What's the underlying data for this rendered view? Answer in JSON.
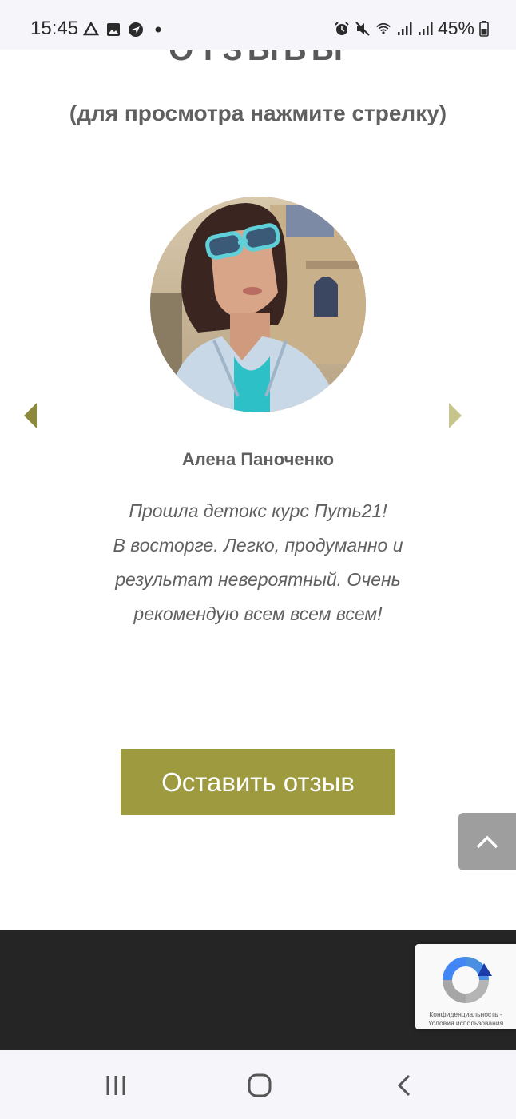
{
  "status_bar": {
    "time": "15:45",
    "battery": "45%",
    "left_icons": [
      "drive-icon",
      "gallery-icon",
      "messenger-icon",
      "dot-icon"
    ],
    "right_icons": [
      "alarm-icon",
      "mute-icon",
      "wifi-icon",
      "signal-icon",
      "signal-icon",
      "battery-icon"
    ]
  },
  "section": {
    "title": "ОТЗЫВЫ",
    "subtitle": "(для просмотра нажмите стрелку)"
  },
  "review": {
    "name": "Алена Паноченко",
    "text_lines": [
      "Прошла детокс курс Путь21!",
      "В восторге. Легко, продуманно и",
      "результат невероятный. Очень",
      "рекомендую всем всем всем!"
    ]
  },
  "buttons": {
    "leave_review": "Оставить отзыв"
  },
  "recaptcha": {
    "line1": "Конфиденциальность -",
    "line2": "Условия использования"
  },
  "colors": {
    "accent": "#9d9a40",
    "arrow_active": "#8c8a3a",
    "arrow_inactive": "#c7c48c",
    "footer": "#252525",
    "scroll_top": "#9e9e9e"
  }
}
